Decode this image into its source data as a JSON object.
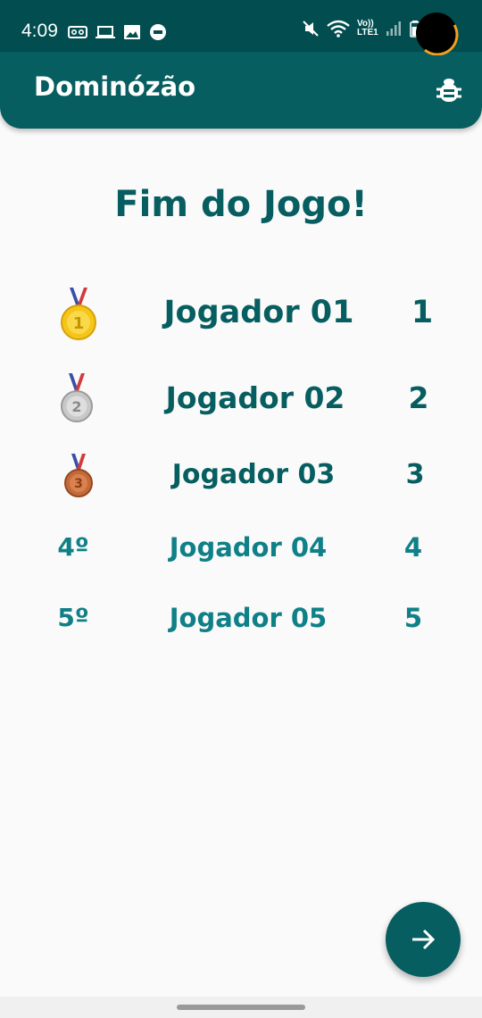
{
  "status_bar": {
    "time": "4:09",
    "network_label": "LTE1",
    "volte_label": "Vo))",
    "icons": [
      "voicemail-icon",
      "laptop-icon",
      "image-icon",
      "app-badge-icon",
      "mute-icon",
      "wifi-icon",
      "signal-icon",
      "battery-icon"
    ]
  },
  "app_bar": {
    "title": "Dominózão",
    "action_icon": "bug-icon"
  },
  "page": {
    "title": "Fim do Jogo!"
  },
  "ranking": [
    {
      "position": "1",
      "badge": "gold-medal-icon",
      "name": "Jogador 01",
      "score": "1"
    },
    {
      "position": "2",
      "badge": "silver-medal-icon",
      "name": "Jogador 02",
      "score": "2"
    },
    {
      "position": "3",
      "badge": "bronze-medal-icon",
      "name": "Jogador 03",
      "score": "3"
    },
    {
      "position": "4º",
      "badge": "",
      "name": "Jogador 04",
      "score": "4"
    },
    {
      "position": "5º",
      "badge": "",
      "name": "Jogador 05",
      "score": "5"
    }
  ],
  "fab": {
    "icon": "arrow-right-icon"
  },
  "colors": {
    "primary": "#075e60",
    "status_bar": "#014d4f",
    "accent_text": "#0f8087",
    "background": "#fafafa",
    "gold": "#f5c518",
    "silver": "#c8c8c8",
    "bronze": "#c46a3a",
    "ribbon_blue": "#3a4fa8",
    "ribbon_red": "#d23b3b"
  }
}
